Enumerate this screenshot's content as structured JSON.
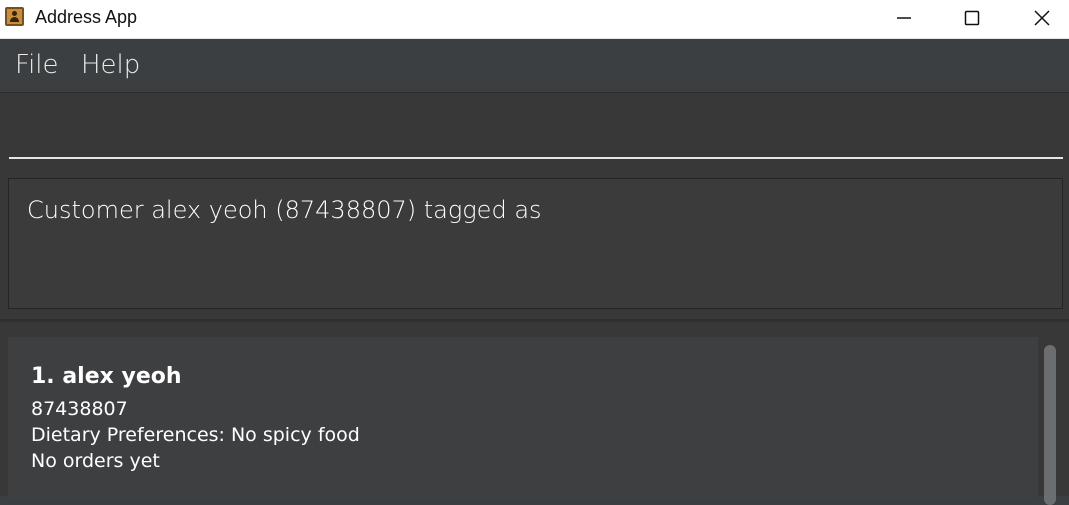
{
  "window": {
    "title": "Address App",
    "icon": "address-book-icon",
    "controls": [
      "minimize-icon",
      "maximize-icon",
      "close-icon"
    ]
  },
  "menu": {
    "file": "File",
    "help": "Help"
  },
  "command": {
    "value": ""
  },
  "result": {
    "message": "Customer alex yeoh (87438807) tagged as"
  },
  "persons": [
    {
      "name": "1. alex yeoh",
      "phone": "87438807",
      "dietary": "Dietary Preferences: No spicy food",
      "orders": "No orders yet"
    }
  ],
  "colors": {
    "background": "#3c3f41",
    "panel": "#383838",
    "card": "#3e3f41",
    "text": "#ffffff"
  }
}
